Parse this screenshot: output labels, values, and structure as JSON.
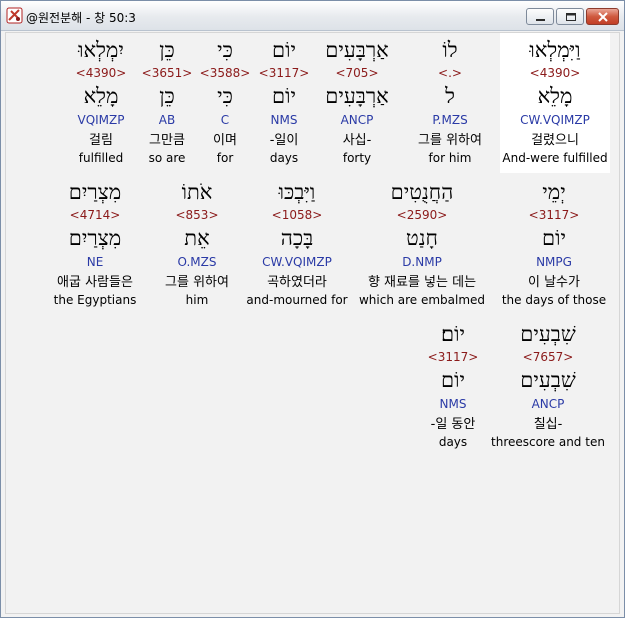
{
  "window": {
    "title": "@원전분해 - 창 50:3"
  },
  "rows": [
    {
      "words": [
        {
          "hebrew": "וַיִּמְלְאוּ",
          "strong": "<4390>",
          "lemma": "מָלֵא",
          "parse": "CW.VQIMZP",
          "korean": "걸렸으니",
          "english": "And-were fulfilled",
          "highlight": true
        },
        {
          "hebrew": "לוֹ",
          "strong": "<.>",
          "lemma": "ל",
          "parse": "P.MZS",
          "korean": "그를 위하여",
          "english": "for him"
        },
        {
          "hebrew": "אַרְבָּעִים",
          "strong": "<705>",
          "lemma": "אַרְבָּעִים",
          "parse": "ANCP",
          "korean": "사십-",
          "english": "forty"
        },
        {
          "hebrew": "יוֹם",
          "strong": "<3117>",
          "lemma": "יוֹם",
          "parse": "NMS",
          "korean": "-일이",
          "english": "days"
        },
        {
          "hebrew": "כִּי",
          "strong": "<3588>",
          "lemma": "כִּי",
          "parse": "C",
          "korean": "이며",
          "english": "for"
        },
        {
          "hebrew": "כֵּן",
          "strong": "<3651>",
          "lemma": "כֵּן",
          "parse": "AB",
          "korean": "그만큼",
          "english": "so are"
        },
        {
          "hebrew": "יִמְלְאוּ",
          "strong": "<4390>",
          "lemma": "מָלֵא",
          "parse": "VQIMZP",
          "korean": "걸림",
          "english": "fulfilled"
        }
      ]
    },
    {
      "words": [
        {
          "hebrew": "יְמֵי",
          "strong": "<3117>",
          "lemma": "יוֹם",
          "parse": "NMPG",
          "korean": "이 날수가",
          "english": "the days of those"
        },
        {
          "hebrew": "הַחֲנֻטִים",
          "strong": "<2590>",
          "lemma": "חָנַט",
          "parse": "D.NMP",
          "korean": "향 재료를 넣는 데는",
          "english": "which are embalmed"
        },
        {
          "hebrew": "וַיִּבְכּוּ",
          "strong": "<1058>",
          "lemma": "בָּכָה",
          "parse": "CW.VQIMZP",
          "korean": "곡하였더라",
          "english": "and-mourned for"
        },
        {
          "hebrew": "אֹתוֹ",
          "strong": "<853>",
          "lemma": "אֵת",
          "parse": "O.MZS",
          "korean": "그를 위하여",
          "english": "him"
        },
        {
          "hebrew": "מִצְרַיִם",
          "strong": "<4714>",
          "lemma": "מִצְרַיִם",
          "parse": "NE",
          "korean": "애굽 사람들은",
          "english": "the Egyptians"
        }
      ]
    },
    {
      "words": [
        {
          "hebrew": "שִׁבְעִים",
          "strong": "<7657>",
          "lemma": "שִׁבְעִים",
          "parse": "ANCP",
          "korean": "칠십-",
          "english": "threescore and ten"
        },
        {
          "hebrew": "יוֹם׃",
          "strong": "<3117>",
          "lemma": "יוֹם",
          "parse": "NMS",
          "korean": "-일 동안",
          "english": "days"
        }
      ]
    }
  ]
}
